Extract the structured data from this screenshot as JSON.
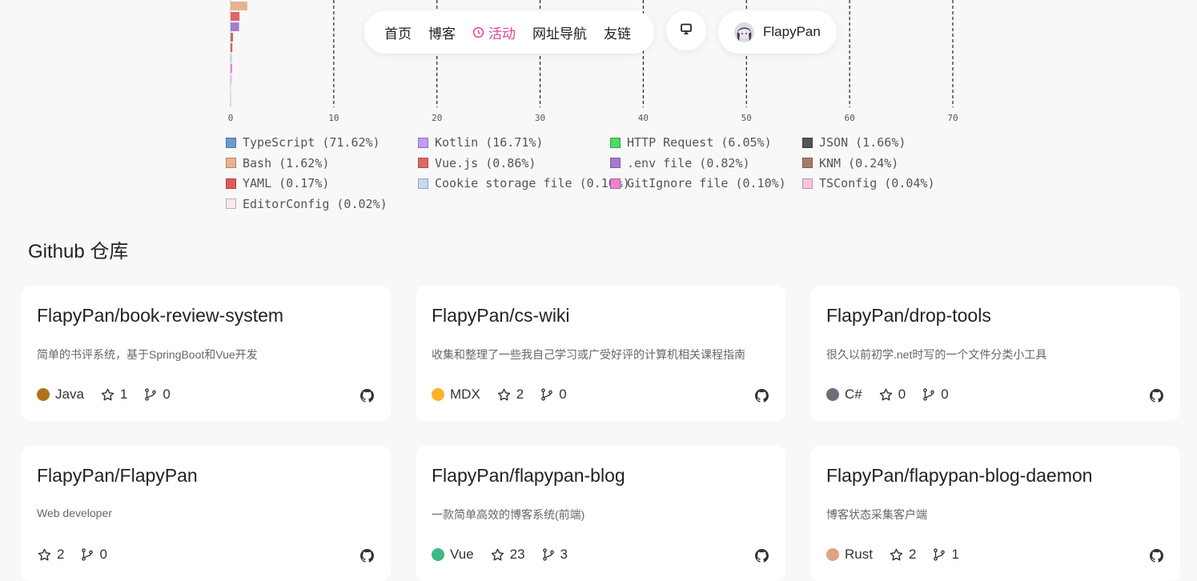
{
  "nav": {
    "items": [
      {
        "label": "首页",
        "active": false
      },
      {
        "label": "博客",
        "active": false
      },
      {
        "label": "活动",
        "active": true
      },
      {
        "label": "网址导航",
        "active": false
      },
      {
        "label": "友链",
        "active": false
      }
    ],
    "user_name": "FlapyPan",
    "theme_icon": "monitor-icon",
    "active_color": "#e0439a"
  },
  "chart_data": {
    "type": "bar",
    "orientation": "horizontal",
    "x_ticks": [
      "0",
      "10",
      "20",
      "30",
      "40",
      "50",
      "60",
      "70"
    ],
    "xlim": [
      0,
      70
    ],
    "grid": "dashed vertical",
    "series": [
      {
        "name": "TypeScript",
        "percent": "71.62%",
        "value": 71.62,
        "color": "#6b9bd1"
      },
      {
        "name": "Kotlin",
        "percent": "16.71%",
        "value": 16.71,
        "color": "#c39cf3"
      },
      {
        "name": "HTTP Request",
        "percent": "6.05%",
        "value": 6.05,
        "color": "#4cd964"
      },
      {
        "name": "JSON",
        "percent": "1.66%",
        "value": 1.66,
        "color": "#555555"
      },
      {
        "name": "Bash",
        "percent": "1.62%",
        "value": 1.62,
        "color": "#e8b28e"
      },
      {
        "name": "Vue.js",
        "percent": "0.86%",
        "value": 0.86,
        "color": "#e06666"
      },
      {
        "name": ".env file",
        "percent": "0.82%",
        "value": 0.82,
        "color": "#a77ccf"
      },
      {
        "name": "KNM",
        "percent": "0.24%",
        "value": 0.24,
        "color": "#a97a6e"
      },
      {
        "name": "YAML",
        "percent": "0.17%",
        "value": 0.17,
        "color": "#e05a5a"
      },
      {
        "name": "Cookie storage file",
        "percent": "0.10%",
        "value": 0.1,
        "color": "#c7d9f1"
      },
      {
        "name": "GitIgnore file",
        "percent": "0.10%",
        "value": 0.1,
        "color": "#ee82d0"
      },
      {
        "name": "TSConfig",
        "percent": "0.04%",
        "value": 0.04,
        "color": "#f7c6dc"
      },
      {
        "name": "EditorConfig",
        "percent": "0.02%",
        "value": 0.02,
        "color": "#fde9ef"
      }
    ]
  },
  "repos_section": {
    "title": "Github 仓库",
    "repos": [
      {
        "name": "FlapyPan/book-review-system",
        "description": "简单的书评系统，基于SpringBoot和Vue开发",
        "language": "Java",
        "language_color": "#b07219",
        "stars": "1",
        "forks": "0"
      },
      {
        "name": "FlapyPan/cs-wiki",
        "description": "收集和整理了一些我自己学习或广受好评的计算机相关课程指南",
        "language": "MDX",
        "language_color": "#fcb32c",
        "stars": "2",
        "forks": "0"
      },
      {
        "name": "FlapyPan/drop-tools",
        "description": "很久以前初学.net时写的一个文件分类小工具",
        "language": "C#",
        "language_color": "#6e6e78",
        "stars": "0",
        "forks": "0"
      },
      {
        "name": "FlapyPan/FlapyPan",
        "description": "Web developer",
        "language": null,
        "language_color": null,
        "stars": "2",
        "forks": "0"
      },
      {
        "name": "FlapyPan/flapypan-blog",
        "description": "一款简单高效的博客系统(前端)",
        "language": "Vue",
        "language_color": "#41b883",
        "stars": "23",
        "forks": "3"
      },
      {
        "name": "FlapyPan/flapypan-blog-daemon",
        "description": "博客状态采集客户端",
        "language": "Rust",
        "language_color": "#dea584",
        "stars": "2",
        "forks": "1"
      }
    ]
  }
}
